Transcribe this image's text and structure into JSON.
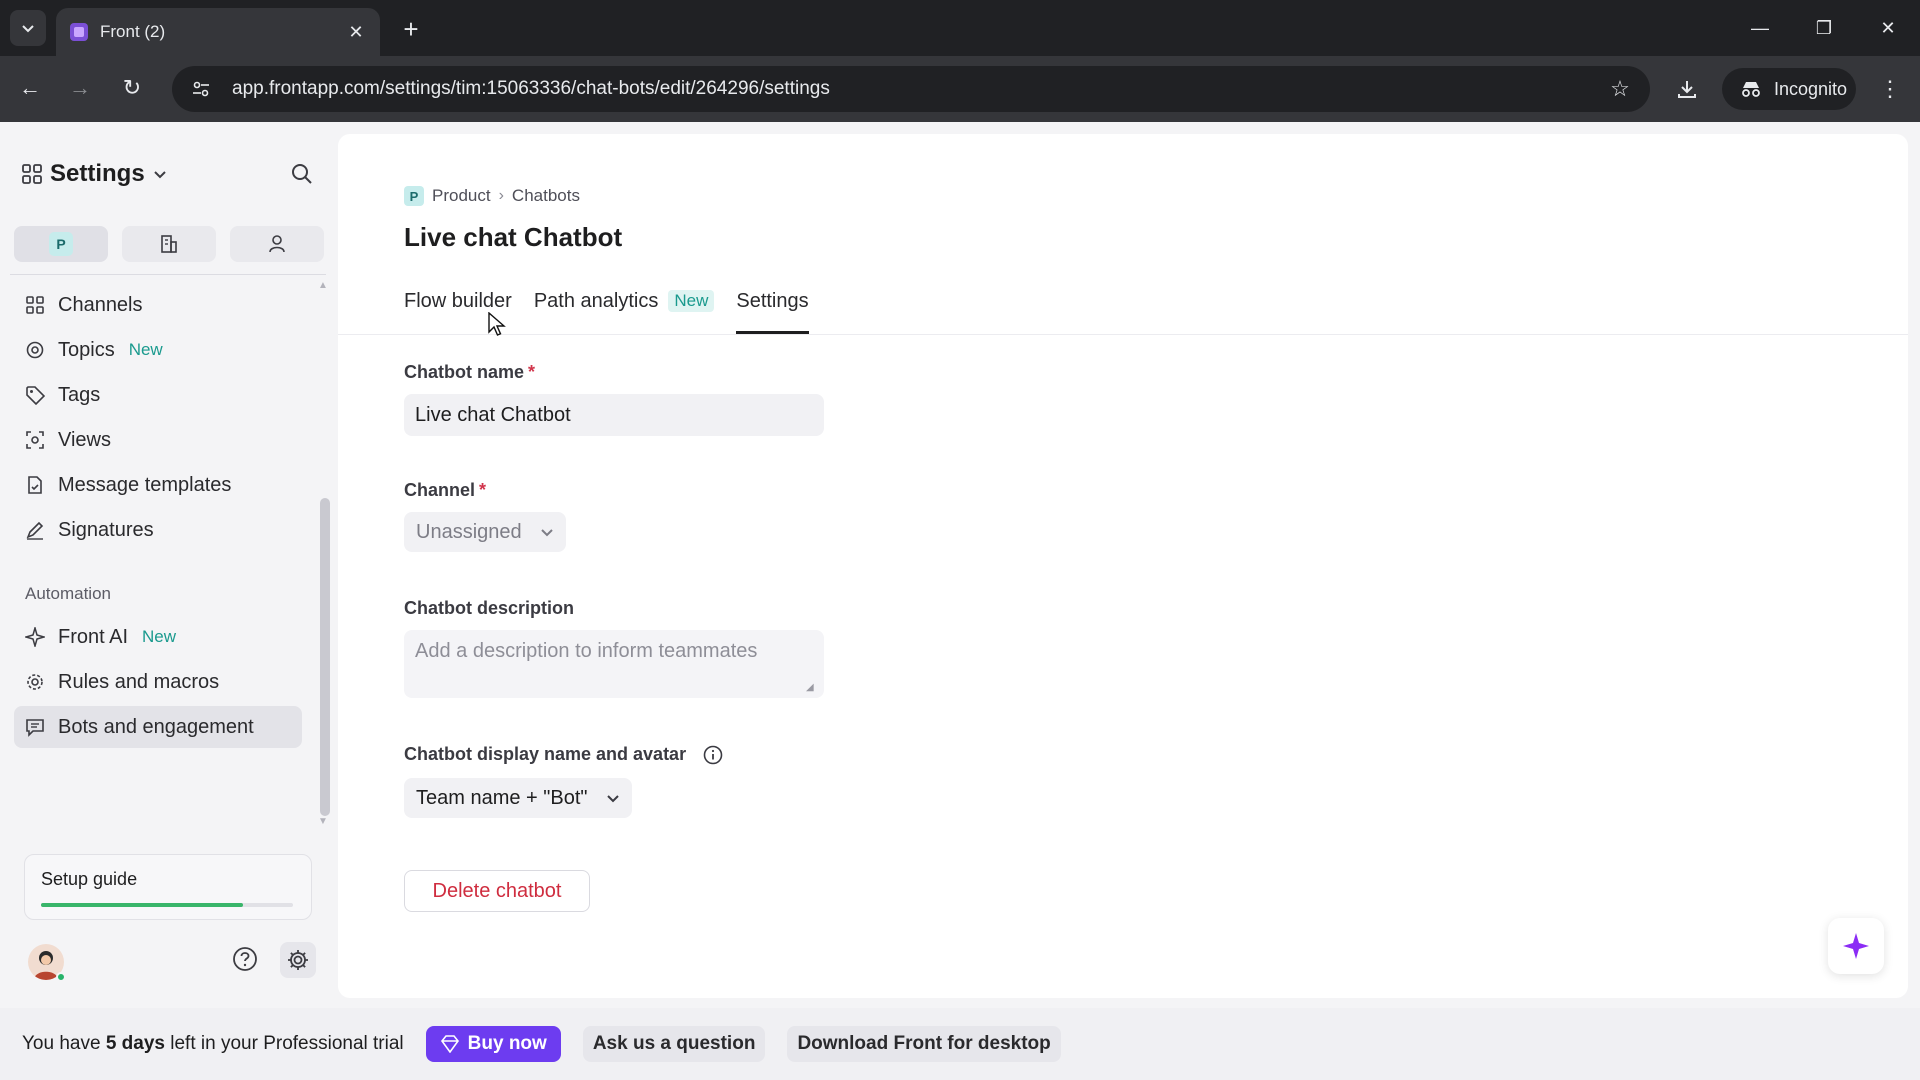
{
  "browser": {
    "tab_title": "Front (2)",
    "url": "app.frontapp.com/settings/tim:15063336/chat-bots/edit/264296/settings",
    "incognito_label": "Incognito"
  },
  "sidebar": {
    "title": "Settings",
    "scope_chip": "P",
    "items": [
      {
        "label": "Channels",
        "icon": "grid-icon"
      },
      {
        "label": "Topics",
        "icon": "topics-icon",
        "badge": "New"
      },
      {
        "label": "Tags",
        "icon": "tag-icon"
      },
      {
        "label": "Views",
        "icon": "views-icon"
      },
      {
        "label": "Message templates",
        "icon": "template-icon"
      },
      {
        "label": "Signatures",
        "icon": "pen-icon"
      }
    ],
    "automation_label": "Automation",
    "automation_items": [
      {
        "label": "Front AI",
        "icon": "sparkle-icon",
        "badge": "New"
      },
      {
        "label": "Rules and macros",
        "icon": "gear-icon"
      },
      {
        "label": "Bots and engagement",
        "icon": "chat-icon",
        "selected": true
      }
    ],
    "setup_guide": {
      "label": "Setup guide",
      "progress": 0.8
    }
  },
  "main": {
    "breadcrumb": {
      "chip": "P",
      "product": "Product",
      "section": "Chatbots"
    },
    "title": "Live chat Chatbot",
    "tabs": [
      {
        "label": "Flow builder"
      },
      {
        "label": "Path analytics",
        "badge": "New"
      },
      {
        "label": "Settings",
        "active": true
      }
    ],
    "form": {
      "name_label": "Chatbot name",
      "name_value": "Live chat Chatbot",
      "required_mark": "*",
      "channel_label": "Channel",
      "channel_value": "Unassigned",
      "description_label": "Chatbot description",
      "description_placeholder": "Add a description to inform teammates",
      "display_label": "Chatbot display name and avatar",
      "display_value": "Team name + \"Bot\""
    },
    "delete_label": "Delete chatbot"
  },
  "trial_bar": {
    "text_prefix": "You have ",
    "days": "5 days",
    "text_suffix": " left in your Professional trial",
    "buy_label": "Buy now",
    "ask_label": "Ask us a question",
    "download_label": "Download Front for desktop"
  },
  "colors": {
    "accent_purple": "#6d3cf0",
    "badge_teal": "#1a9a8e",
    "danger_red": "#cf2d3f",
    "progress_green": "#39b56a"
  }
}
